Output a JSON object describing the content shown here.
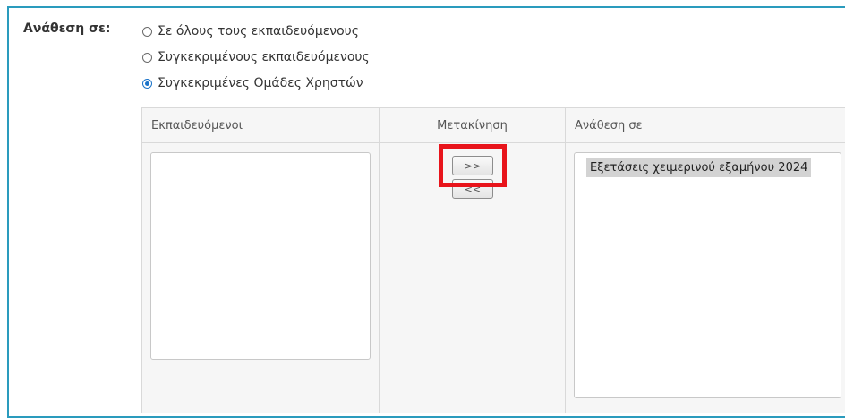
{
  "assign": {
    "label": "Ανάθεση σε:",
    "options": [
      {
        "label": "Σε όλους τους εκπαιδευόμενους",
        "checked": false
      },
      {
        "label": "Συγκεκριμένους εκπαιδευόμενους",
        "checked": false
      },
      {
        "label": "Συγκεκριμένες Ομάδες Χρηστών",
        "checked": true
      }
    ]
  },
  "table": {
    "headers": {
      "trainees": "Εκπαιδευόμενοι",
      "move": "Μετακίνηση",
      "assigned": "Ανάθεση σε"
    },
    "trainees_list": [],
    "assigned_list": [
      "Εξετάσεις χειμερινού εξαμήνου 2024"
    ],
    "buttons": {
      "forward": ">>",
      "back": "<<"
    }
  },
  "colors": {
    "frame_border": "#2a9bbd",
    "highlight": "#e8141b",
    "radio_checked": "#1a73c9"
  }
}
